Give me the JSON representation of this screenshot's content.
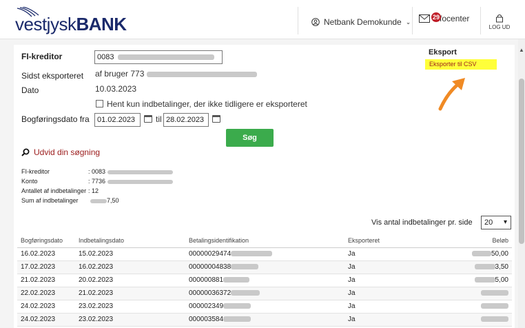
{
  "header": {
    "logo_light": "vestjysk",
    "logo_bold": "BANK",
    "user_label": "Netbank Demokunde",
    "info_label": "Infocenter",
    "info_badge": "29",
    "logout_label": "LOG UD"
  },
  "form": {
    "fi_kreditor_label": "FI-kreditor",
    "fi_kreditor_value": "0083",
    "sidst_label": "Sidst eksporteret",
    "sidst_value": "af bruger 773",
    "dato_label": "Dato",
    "dato_value": "10.03.2023",
    "checkbox_label": "Hent kun indbetalinger, der ikke tidligere er eksporteret",
    "bogf_label": "Bogføringsdato fra",
    "date_from": "01.02.2023",
    "til_label": "til",
    "date_to": "28.02.2023",
    "search_button": "Søg",
    "expand_link": "Udvid din søgning"
  },
  "summary": {
    "fi_label": "FI-kreditor",
    "fi_value": ": 0083",
    "konto_label": "Konto",
    "konto_value": ": 7736",
    "antal_label": "Antallet af indbetalinger",
    "antal_value": ": 12",
    "sum_label": "Sum af indbetalinger",
    "sum_value": "7,50"
  },
  "export": {
    "title": "Eksport",
    "csv_link": "Eksporter til CSV"
  },
  "paging": {
    "label": "Vis antal indbetalinger pr. side",
    "value": "20"
  },
  "table": {
    "headers": [
      "Bogføringsdato",
      "Indbetalingsdato",
      "Betalingsidentifikation",
      "Eksporteret",
      "Beløb"
    ],
    "rows": [
      {
        "bogf": "16.02.2023",
        "indb": "15.02.2023",
        "id": "00000029474",
        "exp": "Ja",
        "amount": "50,00"
      },
      {
        "bogf": "17.02.2023",
        "indb": "16.02.2023",
        "id": "00000004838",
        "exp": "Ja",
        "amount": "3,50"
      },
      {
        "bogf": "21.02.2023",
        "indb": "20.02.2023",
        "id": "000000881",
        "exp": "Ja",
        "amount": "5,00"
      },
      {
        "bogf": "22.02.2023",
        "indb": "21.02.2023",
        "id": "00000036372",
        "exp": "Ja",
        "amount": ""
      },
      {
        "bogf": "24.02.2023",
        "indb": "23.02.2023",
        "id": "000002349",
        "exp": "Ja",
        "amount": ""
      },
      {
        "bogf": "24.02.2023",
        "indb": "23.02.2023",
        "id": "000003584",
        "exp": "Ja",
        "amount": ""
      }
    ]
  },
  "colors": {
    "brand_navy": "#1b2a6b",
    "search_green": "#3bab4c",
    "link_red": "#9b1b1b",
    "highlight_yellow": "#ffff3a",
    "arrow_orange": "#f08a24"
  }
}
